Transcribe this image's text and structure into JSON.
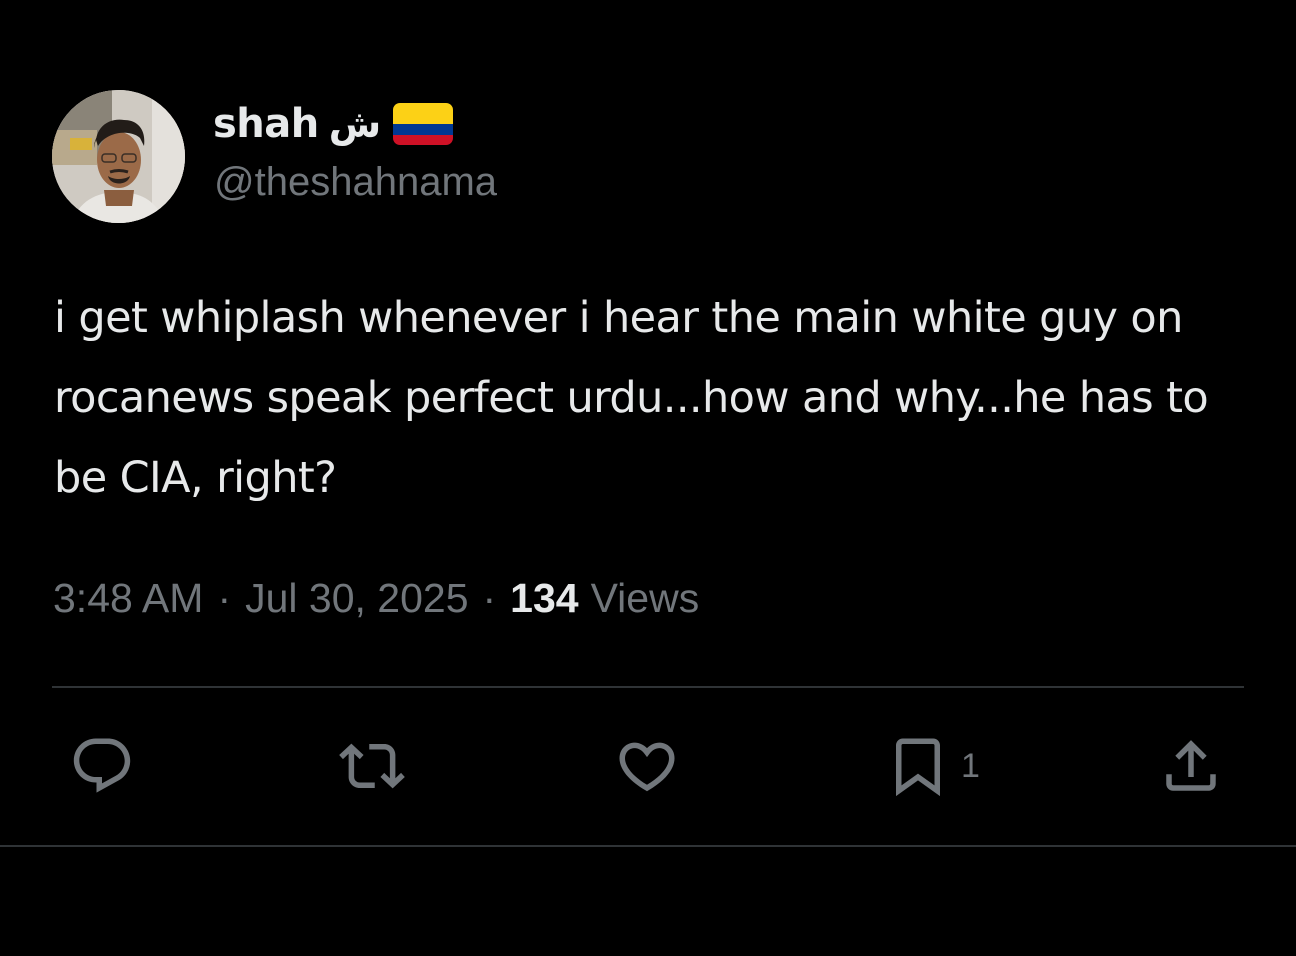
{
  "author": {
    "display_name": "shah",
    "name_suffix": "ش",
    "handle": "@theshahnama",
    "flag_colors": [
      "#fcd116",
      "#003893",
      "#ce1126"
    ]
  },
  "tweet": {
    "text": "i get whiplash whenever i hear the main white guy on rocanews speak perfect urdu...how and why...he has to be CIA, right?",
    "time": "3:48 AM",
    "date": "Jul 30, 2025",
    "separator": "·",
    "views_count": "134",
    "views_label": "Views"
  },
  "actions": {
    "reply_icon": "reply-icon",
    "retweet_icon": "retweet-icon",
    "like_icon": "heart-icon",
    "bookmark_icon": "bookmark-icon",
    "bookmark_count": "1",
    "share_icon": "share-icon"
  },
  "colors": {
    "background": "#000000",
    "text_primary": "#e7e9ea",
    "text_secondary": "#71767b",
    "divider": "#2f3336"
  }
}
